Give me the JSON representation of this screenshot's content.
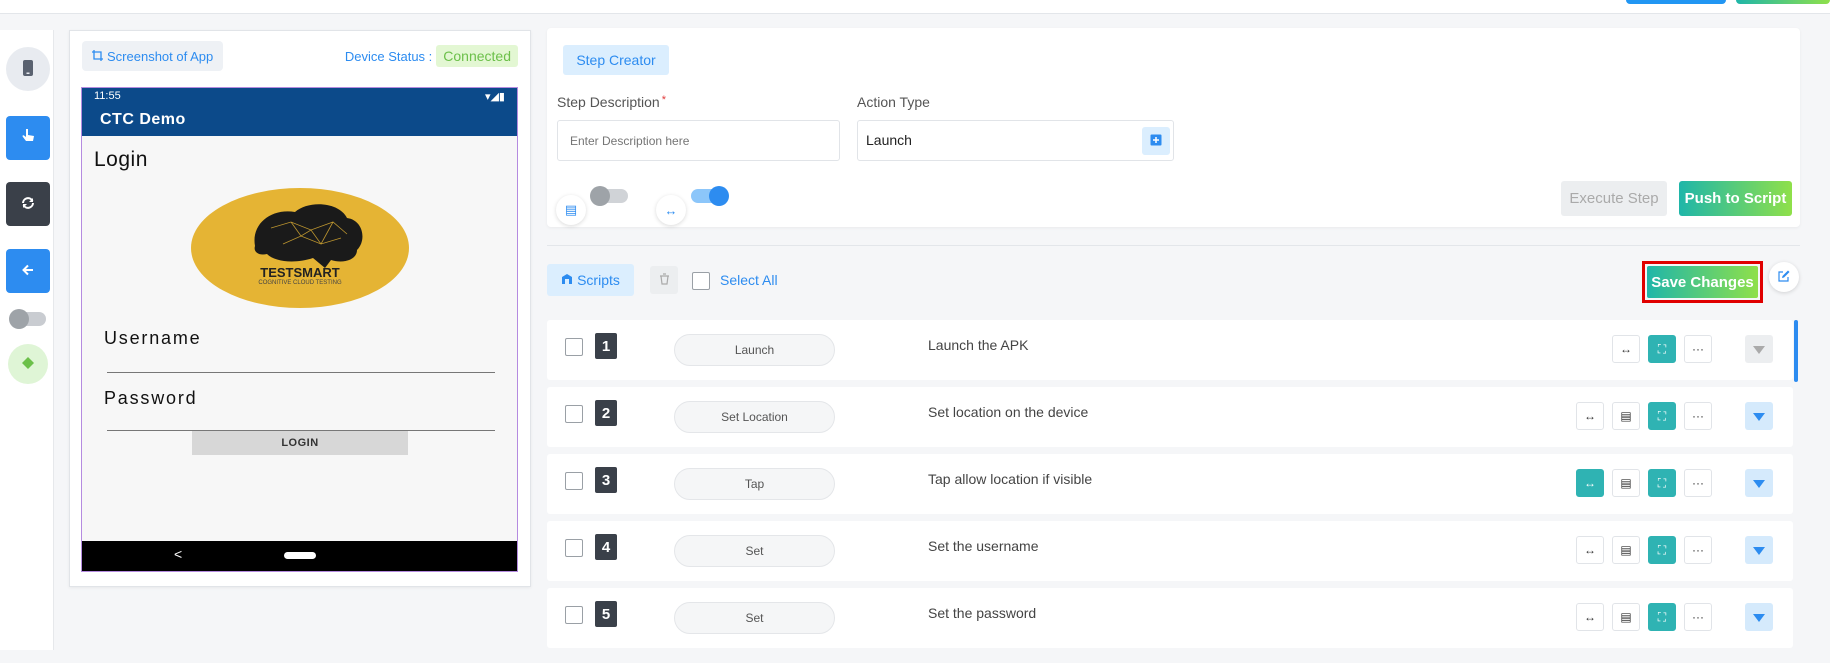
{
  "rail": {
    "icons": [
      "phone-icon",
      "tap-icon",
      "sync-icon",
      "arrow-left-icon",
      "android-icon"
    ]
  },
  "device_panel": {
    "screenshot_label": "Screenshot of App",
    "status_label": "Device Status :",
    "status_value": "Connected"
  },
  "phone": {
    "time": "11:55",
    "app_title": "CTC Demo",
    "login_title": "Login",
    "logo_text": "TESTSMART",
    "logo_sub": "COGNITIVE CLOUD TESTING",
    "username_label": "Username",
    "password_label": "Password",
    "login_button": "LOGIN",
    "nav_back": "<"
  },
  "creator": {
    "tab_label": "Step Creator",
    "description_label": "Step Description",
    "required_mark": "*",
    "description_placeholder": "Enter Description here",
    "action_type_label": "Action Type",
    "action_type_value": "Launch",
    "execute_button": "Execute Step",
    "push_button": "Push to Script"
  },
  "scripts": {
    "scripts_label": "Scripts",
    "select_all_label": "Select All",
    "save_button": "Save Changes",
    "steps": [
      {
        "num": "1",
        "action": "Launch",
        "description": "Launch the APK"
      },
      {
        "num": "2",
        "action": "Set Location",
        "description": "Set location on the device"
      },
      {
        "num": "3",
        "action": "Tap",
        "description": "Tap allow location if visible"
      },
      {
        "num": "4",
        "action": "Set",
        "description": "Set the username"
      },
      {
        "num": "5",
        "action": "Set",
        "description": "Set the password"
      }
    ]
  },
  "colors": {
    "accent": "#2d8cf0",
    "teal": "#2fb3b3",
    "gradient_start": "#1fb6a9",
    "gradient_end": "#8fe04a",
    "highlight": "#e00000"
  }
}
